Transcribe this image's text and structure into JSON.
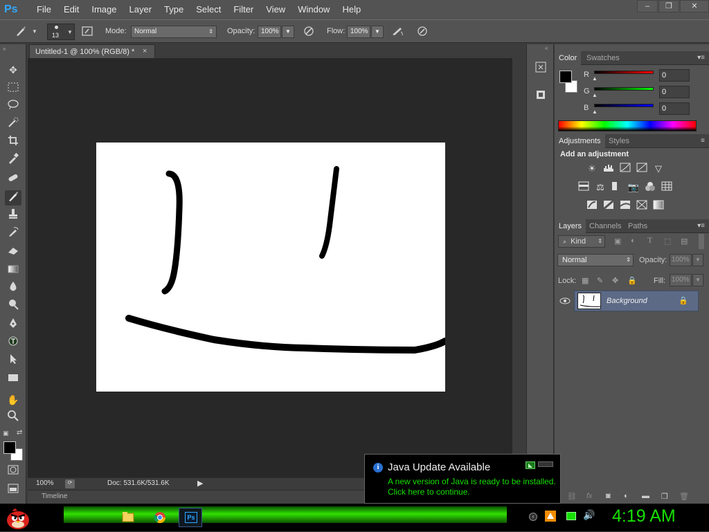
{
  "app": {
    "logo_text": "Ps"
  },
  "menu": [
    "File",
    "Edit",
    "Image",
    "Layer",
    "Type",
    "Select",
    "Filter",
    "View",
    "Window",
    "Help"
  ],
  "window_controls": {
    "minimize": "–",
    "restore": "❐",
    "close": "✕"
  },
  "options_bar": {
    "brush_size": "13",
    "mode_label": "Mode:",
    "mode_value": "Normal",
    "opacity_label": "Opacity:",
    "opacity_value": "100%",
    "flow_label": "Flow:",
    "flow_value": "100%"
  },
  "document": {
    "tab_title": "Untitled-1 @ 100% (RGB/8) *",
    "tab_close": "×"
  },
  "status_bar": {
    "zoom": "100%",
    "doc_info": "Doc: 531.6K/531.6K"
  },
  "timeline": {
    "label": "Timeline"
  },
  "color_panel": {
    "tabs": [
      "Color",
      "Swatches"
    ],
    "channels": [
      {
        "label": "R",
        "value": "0"
      },
      {
        "label": "G",
        "value": "0"
      },
      {
        "label": "B",
        "value": "0"
      }
    ],
    "foreground": "#000000",
    "background": "#ffffff"
  },
  "adjustments_panel": {
    "tabs": [
      "Adjustments",
      "Styles"
    ],
    "heading": "Add an adjustment"
  },
  "layers_panel": {
    "tabs": [
      "Layers",
      "Channels",
      "Paths"
    ],
    "filter_kind": "Kind",
    "blend_mode": "Normal",
    "opacity_label": "Opacity:",
    "opacity_value": "100%",
    "lock_label": "Lock:",
    "fill_label": "Fill:",
    "fill_value": "100%",
    "layers": [
      {
        "name": "Background",
        "visible": true,
        "locked": true
      }
    ]
  },
  "notification": {
    "title": "Java Update Available",
    "line1": "A new version of Java is ready to be installed.",
    "line2": "Click here to continue."
  },
  "taskbar": {
    "clock": "4:19 AM"
  },
  "colors": {
    "accent_green": "#16e000",
    "layer_selected": "#5c6a86",
    "panel_bg": "#535353",
    "workspace_bg": "#282828"
  }
}
